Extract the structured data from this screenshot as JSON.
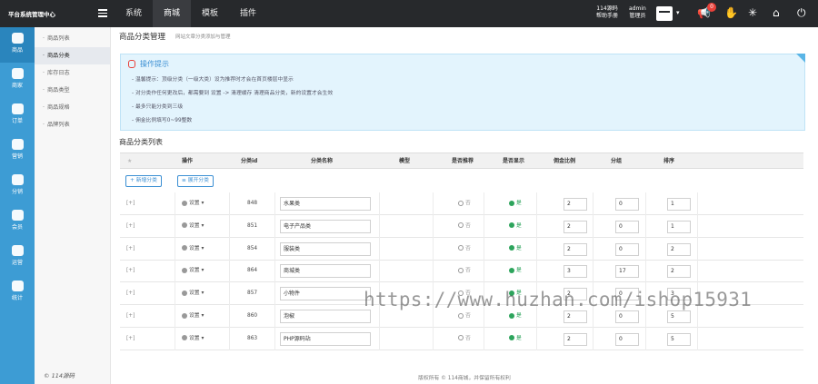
{
  "topbar": {
    "brand": "平台系统管理中心",
    "nav": [
      "系统",
      "商城",
      "模板",
      "插件"
    ],
    "active_nav": "商城",
    "help_line1": "114源码",
    "help_line2": "帮助手册",
    "user_line1": "admin",
    "user_line2": "管理员",
    "notify_count": "0"
  },
  "sidebar": {
    "items": [
      {
        "label": "商品",
        "icon": "bag-icon"
      },
      {
        "label": "商家",
        "icon": "store-icon"
      },
      {
        "label": "订单",
        "icon": "order-icon"
      },
      {
        "label": "营销",
        "icon": "gift-icon"
      },
      {
        "label": "分销",
        "icon": "share-icon"
      },
      {
        "label": "会员",
        "icon": "member-icon"
      },
      {
        "label": "运营",
        "icon": "ops-icon"
      },
      {
        "label": "统计",
        "icon": "stats-icon"
      }
    ],
    "active": "商品"
  },
  "submenu": {
    "items": [
      "商品列表",
      "商品分类",
      "库存日志",
      "商品类型",
      "商品规格",
      "品牌列表"
    ],
    "active": "商品分类"
  },
  "left_copyright": "© 114源码",
  "page": {
    "title": "商品分类管理",
    "subtitle": "网站文章分类添加与管理"
  },
  "tips": {
    "heading": "操作提示",
    "lines": [
      "温馨提示：顶级分类（一级大类）设为推荐时才会在首页楼层中显示",
      "对分类作任何更改后，都需要到 设置 -> 清理缓存 清理商品分类，新的设置才会生效",
      "最多只能分类到三级",
      "佣金比例填写0~99整数"
    ]
  },
  "list": {
    "title": "商品分类列表",
    "headers": {
      "op": "操作",
      "id": "分类id",
      "name": "分类名称",
      "type": "模型",
      "recommend": "是否推荐",
      "show": "是否显示",
      "commission": "佣金比例",
      "group": "分组",
      "sort": "排序"
    },
    "buttons": {
      "add": "新增分类",
      "expand": "展开分类"
    },
    "settings_label": "设置",
    "rows": [
      {
        "expand": "[+]",
        "id": "848",
        "name": "水果类",
        "recommend": "否",
        "show": "是",
        "commission": "2",
        "group": "0",
        "sort": "1"
      },
      {
        "expand": "[+]",
        "id": "851",
        "name": "电子产品类",
        "recommend": "否",
        "show": "是",
        "commission": "2",
        "group": "0",
        "sort": "1"
      },
      {
        "expand": "[+]",
        "id": "854",
        "name": "服装类",
        "recommend": "否",
        "show": "是",
        "commission": "2",
        "group": "0",
        "sort": "2"
      },
      {
        "expand": "[+]",
        "id": "864",
        "name": "商城类",
        "recommend": "否",
        "show": "是",
        "commission": "3",
        "group": "17",
        "sort": "2"
      },
      {
        "expand": "[+]",
        "id": "857",
        "name": "小物件",
        "recommend": "否",
        "show": "是",
        "commission": "2",
        "group": "0",
        "sort": "3"
      },
      {
        "expand": "[+]",
        "id": "860",
        "name": "泡椒",
        "recommend": "否",
        "show": "是",
        "commission": "2",
        "group": "0",
        "sort": "5"
      },
      {
        "expand": "[+]",
        "id": "863",
        "name": "PHP源码站",
        "recommend": "否",
        "show": "是",
        "commission": "2",
        "group": "0",
        "sort": "5"
      }
    ]
  },
  "footer": "版权所有 © 114商城，并保留所有权利",
  "watermark": "https://www.huzhan.com/ishop15931"
}
